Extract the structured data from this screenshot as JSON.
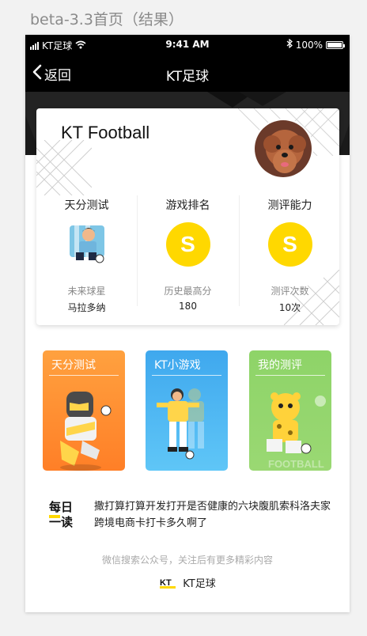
{
  "artboard": {
    "title": "beta-3.3首页（结果）"
  },
  "status_bar": {
    "carrier": "KT足球",
    "time": "9:41 AM",
    "battery": "100%"
  },
  "nav": {
    "back_label": "返回",
    "title": "KT足球"
  },
  "profile": {
    "title": "KT Football"
  },
  "stats": [
    {
      "title": "天分测试",
      "label": "未来球星",
      "value": "马拉多纳"
    },
    {
      "title": "游戏排名",
      "badge": "S",
      "label": "历史最高分",
      "value": "180"
    },
    {
      "title": "测评能力",
      "badge": "S",
      "label": "测评次数",
      "value": "10次"
    }
  ],
  "modes": [
    {
      "title": "天分测试",
      "color": "#ff9b3c"
    },
    {
      "title": "KT小游戏",
      "color": "#47b4f2"
    },
    {
      "title": "我的测评",
      "color": "#8dd168",
      "watermark": "FOOTBALL"
    }
  ],
  "daily": {
    "icon": "daily-read-icon",
    "text": "撒打算打算开发打开是否健康的六块腹肌索科洛夫家跨境电商卡打卡多久啊了"
  },
  "footer": {
    "hint": "微信搜索公众号，关注后有更多精彩内容",
    "brand": "KT足球"
  },
  "colors": {
    "accent_yellow": "#ffd800",
    "nav_bg": "#000000"
  }
}
